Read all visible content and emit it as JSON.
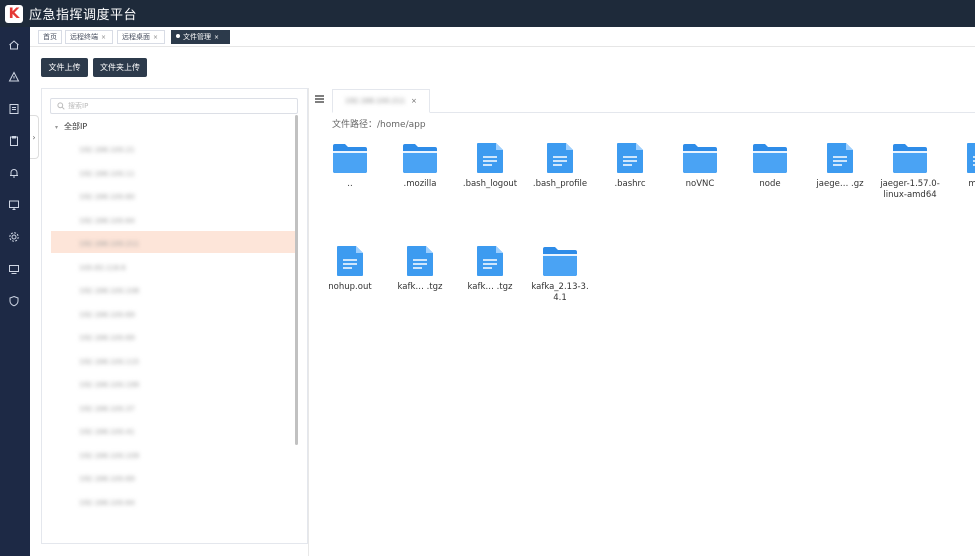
{
  "app": {
    "logo_letter": "K",
    "title": "应急指挥调度平台"
  },
  "sidebar": {
    "icons": [
      "home-icon",
      "alert-icon",
      "document-icon",
      "clipboard-icon",
      "bell-icon",
      "monitor-icon",
      "settings-icon",
      "desktop-icon",
      "shield-icon"
    ]
  },
  "tabs": [
    {
      "label": "首页",
      "closable": false
    },
    {
      "label": "远程终端",
      "closable": true
    },
    {
      "label": "远程桌面",
      "closable": true
    },
    {
      "label": "文件管理",
      "closable": true,
      "active": true
    }
  ],
  "close_glyph": "×",
  "toolbar": {
    "upload_file": "文件上传",
    "upload_folder": "文件夹上传"
  },
  "ip_tree": {
    "search_placeholder": "搜索IP",
    "root_label": "全部IP",
    "items": [
      "192.168.100.21",
      "192.168.100.11",
      "192.168.100.60",
      "192.168.100.64",
      "192.168.100.211",
      "100.83.118.6",
      "192.168.100.108",
      "192.168.100.69",
      "192.168.100.69",
      "192.168.100.115",
      "192.168.100.199",
      "192.168.100.37",
      "192.168.100.41",
      "192.168.100.109",
      "192.168.100.69",
      "192.168.100.64"
    ],
    "selected_index": 4
  },
  "file_panel": {
    "ip_tab_label": "192.168.100.211",
    "path_label": "文件路径：",
    "path_value": "/home/app",
    "files": [
      {
        "name": "..",
        "type": "folder"
      },
      {
        "name": ".mozilla",
        "type": "folder"
      },
      {
        "name": ".bash_logout",
        "type": "file"
      },
      {
        "name": ".bash_profile",
        "type": "file"
      },
      {
        "name": ".bashrc",
        "type": "file"
      },
      {
        "name": "noVNC",
        "type": "folder"
      },
      {
        "name": "node",
        "type": "folder"
      },
      {
        "name": "jaege… .gz",
        "type": "file"
      },
      {
        "name": "jaeger-1.57.0-linux-amd64",
        "type": "folder"
      },
      {
        "name": "mysq",
        "type": "file"
      },
      {
        "name": "nohup.out",
        "type": "file"
      },
      {
        "name": "kafk… .tgz",
        "type": "file"
      },
      {
        "name": "kafk… .tgz",
        "type": "file"
      },
      {
        "name": "kafka_2.13-3.4.1",
        "type": "folder"
      }
    ]
  },
  "colors": {
    "header": "#1e2a3a",
    "sidebar": "#1d2945",
    "accent_button": "#2c3a4b",
    "selected_row": "#fde5d9",
    "file_blue": "#2e8ce8"
  }
}
